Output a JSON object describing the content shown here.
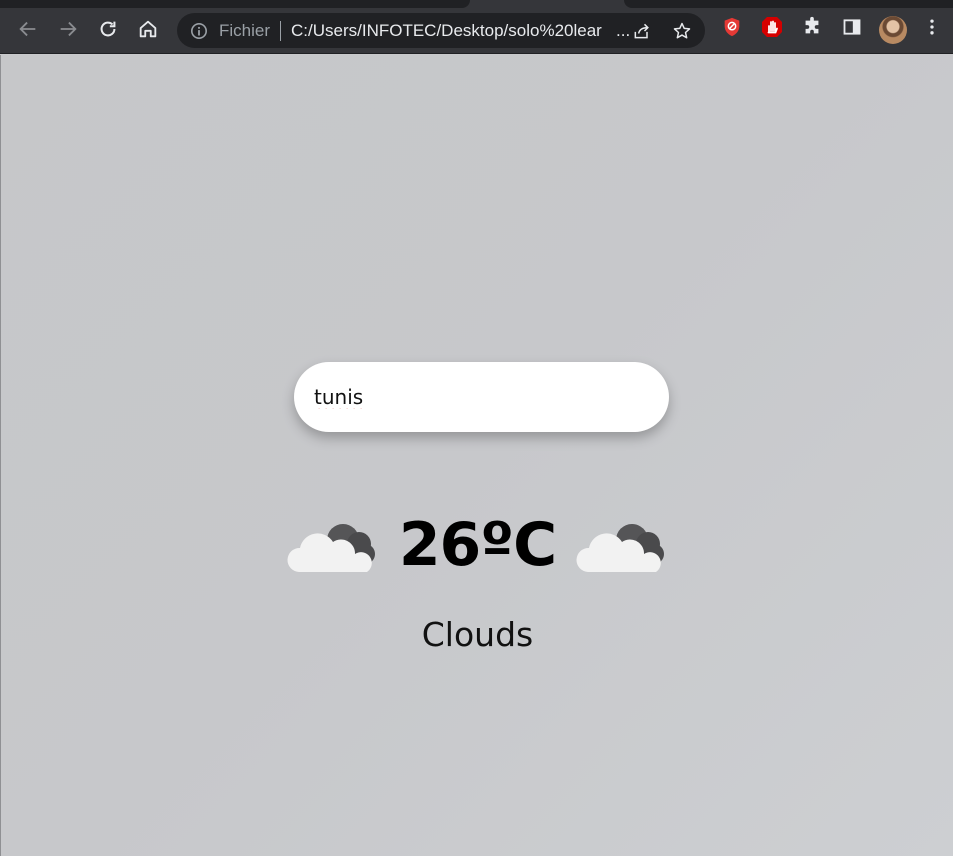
{
  "browser": {
    "scheme_label": "Fichier",
    "url": "C:/Users/INFOTEC/Desktop/solo%20lear",
    "url_ellipsis": "...",
    "toolbar_icons": [
      "back-icon",
      "forward-icon",
      "reload-icon",
      "home-icon",
      "info-icon",
      "share-icon",
      "star-icon"
    ],
    "extension_icons": [
      "shield-extension-icon",
      "hand-stop-extension-icon",
      "puzzle-extensions-icon",
      "sidepanel-icon",
      "profile-avatar",
      "kebab-menu-icon"
    ]
  },
  "search": {
    "value": "tunis"
  },
  "weather": {
    "temperature": "26ºC",
    "condition": "Clouds",
    "icon": "clouds-icon"
  },
  "colors": {
    "chrome_bg": "#35363a",
    "omnibox_bg": "#202124",
    "page_bg": "#c8c9cb",
    "extension_red": "#e53935"
  }
}
